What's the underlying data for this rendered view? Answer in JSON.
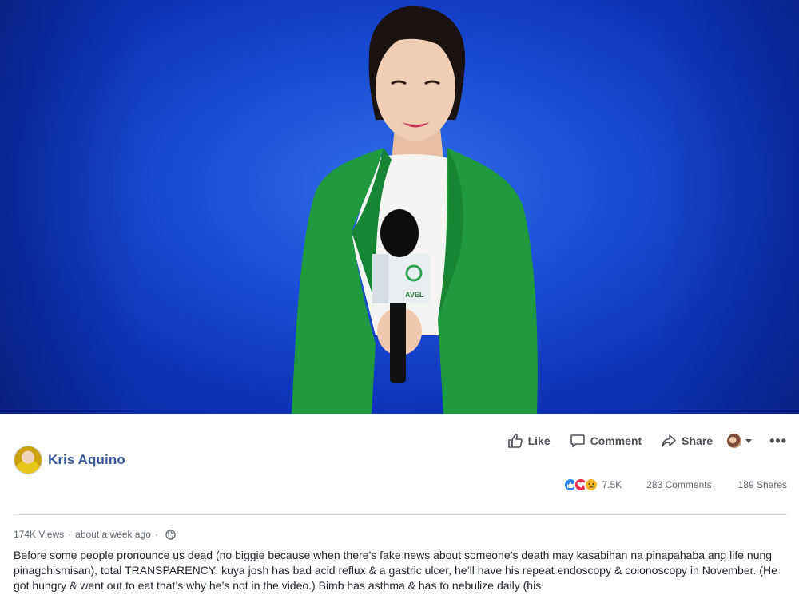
{
  "author": {
    "name": "Kris Aquino"
  },
  "actions": {
    "like_label": "Like",
    "comment_label": "Comment",
    "share_label": "Share"
  },
  "stats": {
    "reaction_count": "7.5K",
    "comments": "283 Comments",
    "shares": "189 Shares",
    "reaction_icons": [
      "like-icon",
      "love-icon",
      "sad-icon"
    ]
  },
  "meta": {
    "views": "174K Views",
    "separator": "·",
    "time": "about a week ago",
    "privacy_icon": "globe-icon"
  },
  "caption": {
    "text": "Before some people pronounce us dead (no biggie because when there’s fake news about someone’s death may kasabihan na pinapahaba ang life nung pinagchismisan), total TRANSPARENCY: kuya josh has bad acid reflux & a gastric ulcer, he’ll have his repeat endoscopy & colonoscopy in November. (He got hungry & went out to eat that’s why he’s not in the video.) Bimb has asthma & has to nebulize daily (his"
  },
  "video": {
    "mic_logo_text": "AVEL"
  },
  "colors": {
    "author_link": "#365899",
    "video_bg": "#1b4fd8",
    "suit": "#1f9a3e"
  }
}
